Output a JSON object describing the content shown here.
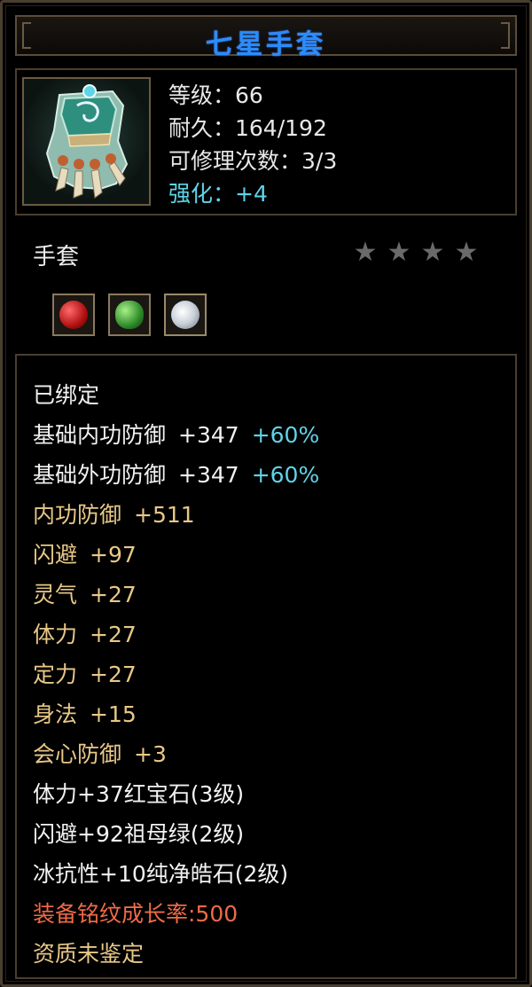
{
  "title": "七星手套",
  "info": {
    "level": "等级：66",
    "durability": "耐久：164/192",
    "repairs": "可修理次数：3/3",
    "enhance": "强化：+4"
  },
  "item_type": "手套",
  "stars": {
    "count": 4,
    "filled": 0
  },
  "gems": [
    {
      "name": "ruby-gem"
    },
    {
      "name": "emerald-gem"
    },
    {
      "name": "diamond-gem"
    }
  ],
  "attributes": {
    "bound": "已绑定",
    "base_inner_def_label": "基础内功防御",
    "base_inner_def_value": "+347",
    "base_inner_def_bonus": "+60%",
    "base_outer_def_label": "基础外功防御",
    "base_outer_def_value": "+347",
    "base_outer_def_bonus": "+60%",
    "inner_def_label": "内功防御",
    "inner_def_value": "+511",
    "dodge_label": "闪避",
    "dodge_value": "+97",
    "spirit_label": "灵气",
    "spirit_value": "+27",
    "stamina_label": "体力",
    "stamina_value": "+27",
    "focus_label": "定力",
    "focus_value": "+27",
    "agility_label": "身法",
    "agility_value": "+15",
    "crit_def_label": "会心防御",
    "crit_def_value": "+3",
    "gem_line_1": "体力+37红宝石(3级)",
    "gem_line_2": "闪避+92祖母绿(2级)",
    "gem_line_3": "冰抗性+10纯净皓石(2级)",
    "growth": "装备铭纹成长率:500",
    "quality": "资质未鉴定"
  },
  "colors": {
    "title": "#2a8cff",
    "white": "#f2f2f2",
    "gold": "#e8c887",
    "cyan": "#5fd4e8",
    "red": "#ef6a48",
    "border": "#4a3e2e"
  }
}
